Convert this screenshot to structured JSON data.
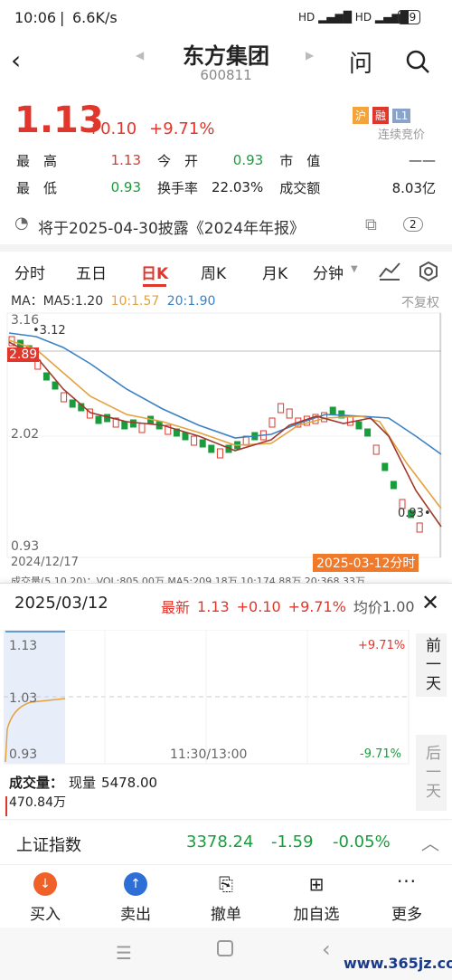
{
  "status_bar": {
    "time": "10:06",
    "speed": "6.6K/s",
    "battery": "69"
  },
  "header": {
    "title": "东方集团",
    "code": "600811",
    "ask_label": "问"
  },
  "quote": {
    "price": "1.13",
    "change": "+0.10",
    "change_pct": "+9.71%",
    "badges": [
      "沪",
      "融",
      "L1"
    ],
    "trade_mode": "连续竞价",
    "high_label": "最　高",
    "high": "1.13",
    "open_label": "今　开",
    "open": "0.93",
    "mktcap_label": "市　值",
    "mktcap": "——",
    "low_label": "最　低",
    "low": "0.93",
    "turnover_label": "换手率",
    "turnover": "22.03%",
    "amount_label": "成交额",
    "amount": "8.03亿"
  },
  "notice": {
    "text": "将于2025-04-30披露《2024年年报》",
    "count": "2"
  },
  "tabs": [
    "分时",
    "五日",
    "日K",
    "周K",
    "月K",
    "分钟"
  ],
  "kchart": {
    "ma_label": "MA：MA5:1.20",
    "ma10": "10:1.57",
    "ma20": "20:1.90",
    "adjust": "不复权",
    "y_top": "3.16",
    "y_mid": "2.02",
    "y_bot": "0.93",
    "high_mark": "3.12",
    "cur_mark": "2.89",
    "low_mark": "0.93",
    "start_date": "2024/12/17",
    "cursor_label": "2025-03-12分时",
    "vol_text": "成交量(5,10,20)：VOL:805.00万 MA5:209.18万 10:174.88万 20:368.33万"
  },
  "intraday": {
    "date": "2025/03/12",
    "latest_label": "最新",
    "latest": "1.13",
    "change": "+0.10",
    "change_pct": "+9.71%",
    "avg_label": "均价",
    "avg": "1.00",
    "y_top": "1.13",
    "y_mid": "1.03",
    "y_bot": "0.93",
    "pct_top": "+9.71%",
    "pct_bot": "-9.71%",
    "time_mid": "11:30/13:00",
    "vol_label": "成交量：",
    "vol_now_label": "现量",
    "vol_now": "5478.00",
    "vol_total": "470.84万",
    "prev_day": "前一天",
    "next_day": "后一天"
  },
  "index_bar": {
    "name": "上证指数",
    "value": "3378.24",
    "change": "-1.59",
    "change_pct": "-0.05%"
  },
  "toolbar": {
    "buy": "买入",
    "sell": "卖出",
    "cancel": "撤单",
    "watch": "加自选",
    "more": "更多"
  },
  "watermark": "www.365jz.com"
}
